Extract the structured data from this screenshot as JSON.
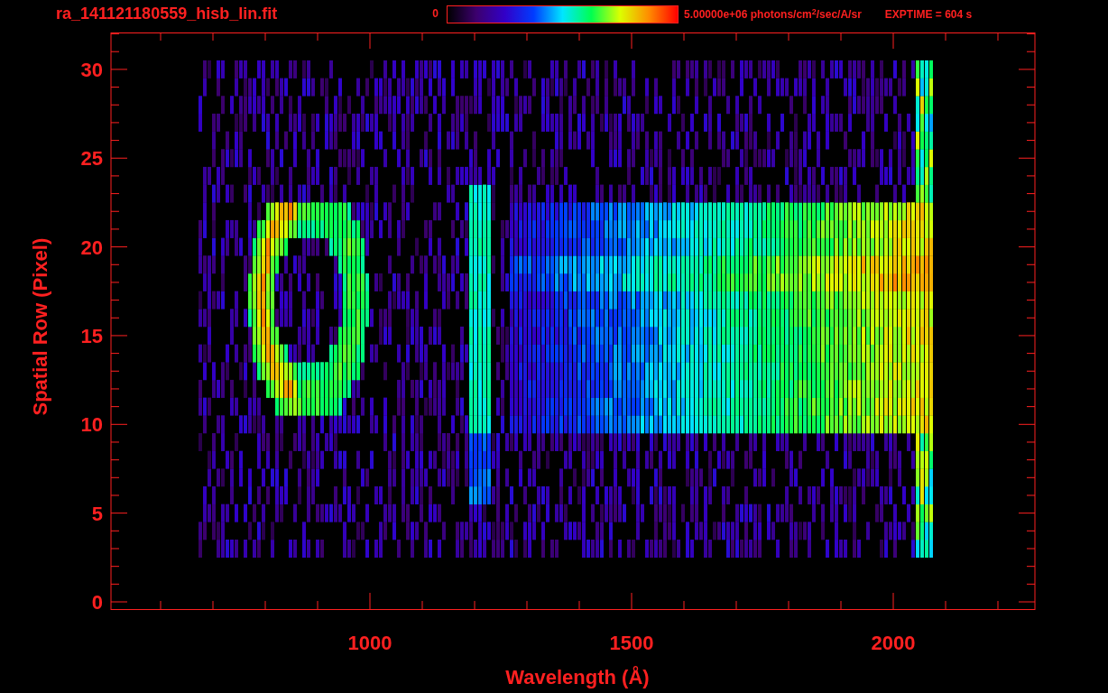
{
  "header": {
    "filename": "ra_141121180559_hisb_lin.fit",
    "colorbar_min": "0",
    "colorbar_max": "5.00000e+06 photons/cm$^{2}$/sec/A/sr",
    "exptime": "EXPTIME = 604 s"
  },
  "y_axis": {
    "title": "Spatial Row (Pixel)",
    "ticks": [
      "30",
      "25",
      "20",
      "15",
      "10",
      "5",
      "0"
    ]
  },
  "x_axis": {
    "title": "Wavelength (Å)",
    "ticks": [
      "1000",
      "1500",
      "2000"
    ]
  }
}
